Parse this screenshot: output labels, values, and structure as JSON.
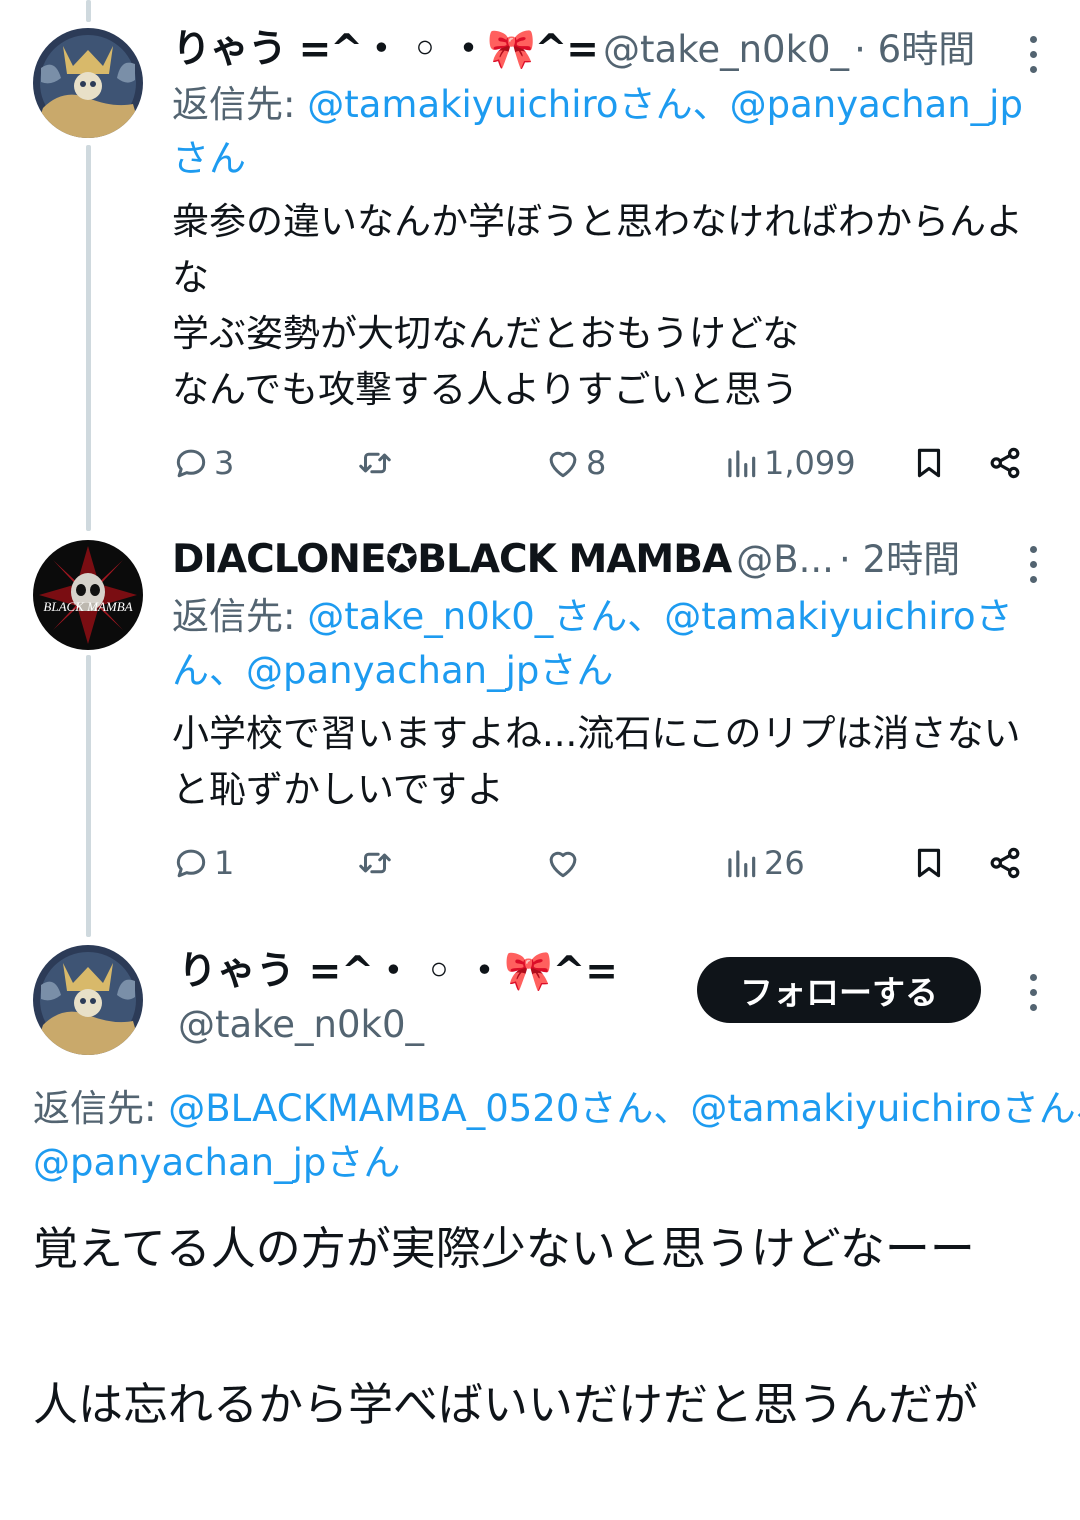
{
  "colors": {
    "text": "#0f1419",
    "secondary": "#536471",
    "link": "#1d9bf0",
    "thread_line": "#cfd9de",
    "button_bg": "#0f1419",
    "button_text": "#ffffff"
  },
  "tweet1": {
    "display_name": "りゃう =^・ ◦ ・🎀^=",
    "handle": "@take_n0k0_",
    "time": "· 6時間",
    "reply_prefix": "返信先:",
    "reply_to": [
      "@tamakiyuichiroさん、",
      "@panyachan_jpさん"
    ],
    "text": "衆参の違いなんか学ぼうと思わなければわからんよな\n学ぶ姿勢が大切なんだとおもうけどな\nなんでも攻撃する人よりすごいと思う",
    "replies": "3",
    "likes": "8",
    "views": "1,099"
  },
  "tweet2": {
    "display_name": "DIACLONE✪BLACK MAMBA",
    "handle": "@B...",
    "time": "· 2時間",
    "avatar_text": "BLACK MAMBA",
    "reply_prefix": "返信先:",
    "reply_to": [
      "@take_n0k0_さん、",
      "@tamakiyuichiroさん、",
      "@panyachan_jpさん"
    ],
    "text": "小学校で習いますよね...流石にこのリプは消さないと恥ずかしいですよ",
    "replies": "1",
    "views": "26"
  },
  "main_tweet": {
    "display_name": "りゃう =^・ ◦ ・🎀^=",
    "handle": "@take_n0k0_",
    "follow_label": "フォローする",
    "reply_prefix": "返信先:",
    "reply_to": [
      "@BLACKMAMBA_0520さん、",
      "@tamakiyuichiroさん、",
      "@panyachan_jpさん"
    ],
    "text": "覚えてる人の方が実際少ないと思うけどなーー\n\n人は忘れるから学べばいいだけだと思うんだが"
  },
  "icons": [
    "reply-icon",
    "retweet-icon",
    "like-icon",
    "views-icon",
    "bookmark-icon",
    "share-icon",
    "more-icon"
  ]
}
